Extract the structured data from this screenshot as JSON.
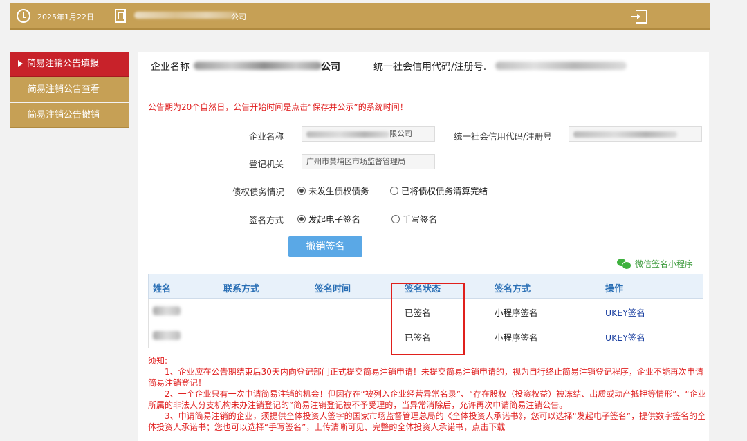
{
  "topbar": {
    "date": "2025年1月22日",
    "company_suffix": "公司"
  },
  "sidebar": {
    "items": [
      {
        "label": "简易注销公告填报",
        "active": true
      },
      {
        "label": "简易注销公告查看",
        "active": false
      },
      {
        "label": "简易注销公告撤销",
        "active": false
      }
    ]
  },
  "header": {
    "company_label": "企业名称",
    "company_suffix": "公司",
    "code_label": "统一社会信用代码/注册号."
  },
  "notice": "公告期为20个自然日，公告开始时间是点击“保存并公示”的系统时间！",
  "form": {
    "company_label": "企业名称",
    "company_value_suffix": "限公司",
    "code_label": "统一社会信用代码/注册号",
    "authority_label": "登记机关",
    "authority_value": "广州市黄埔区市场监督管理局",
    "debt_label": "债权债务情况",
    "debt_options": [
      "未发生债权债务",
      "已将债权债务清算完结"
    ],
    "debt_selected": 0,
    "sign_label": "签名方式",
    "sign_options": [
      "发起电子签名",
      "手写签名"
    ],
    "sign_selected": 0,
    "revoke_button": "撤销签名"
  },
  "wechat_link": "微信签名小程序",
  "table": {
    "headers": [
      "姓名",
      "联系方式",
      "签名时间",
      "签名状态",
      "签名方式",
      "操作"
    ],
    "rows": [
      {
        "status": "已签名",
        "method": "小程序签名",
        "action": "UKEY签名"
      },
      {
        "status": "已签名",
        "method": "小程序签名",
        "action": "UKEY签名"
      }
    ]
  },
  "notes": {
    "title": "须知:",
    "items": [
      "1、企业应在公告期结束后30天内向登记部门正式提交简易注销申请！未提交简易注销申请的，视为自行终止简易注销登记程序，企业不能再次申请简易注销登记！",
      "2、一个企业只有一次申请简易注销的机会！但因存在“被列入企业经营异常名录”、“存在股权（投资权益）被冻结、出质或动产抵押等情形”、“企业所属的非法人分支机构未办注销登记的”简易注销登记被不予受理的，当异常消除后，允许再次申请简易注销公告。",
      "3、申请简易注销的企业，须提供全体投资人签字的国家市场监督管理总局的《全体投资人承诺书》，您可以选择“发起电子签名”，提供数字签名的全体投资人承诺书；您也可以选择“手写签名”，上传清晰可见、完整的全体投资人承诺书，点击下载"
    ]
  }
}
